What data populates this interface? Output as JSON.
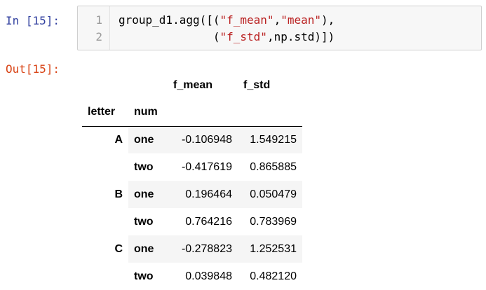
{
  "input_prompt": "In [15]:",
  "output_prompt": "Out[15]:",
  "code": {
    "line_numbers": [
      "1",
      "2"
    ],
    "line1": {
      "p1": "group_d1.agg([(",
      "s1": "\"f_mean\"",
      "p2": ",",
      "s2": "\"mean\"",
      "p3": "),"
    },
    "line2": {
      "indent": "              (",
      "s1": "\"f_std\"",
      "p2": ",np.std)])"
    }
  },
  "dataframe": {
    "columns": [
      "f_mean",
      "f_std"
    ],
    "index_names": [
      "letter",
      "num"
    ],
    "rows": [
      {
        "letter": "A",
        "num": "one",
        "f_mean": "-0.106948",
        "f_std": "1.549215"
      },
      {
        "letter": "",
        "num": "two",
        "f_mean": "-0.417619",
        "f_std": "0.865885"
      },
      {
        "letter": "B",
        "num": "one",
        "f_mean": "0.196464",
        "f_std": "0.050479"
      },
      {
        "letter": "",
        "num": "two",
        "f_mean": "0.764216",
        "f_std": "0.783969"
      },
      {
        "letter": "C",
        "num": "one",
        "f_mean": "-0.278823",
        "f_std": "1.252531"
      },
      {
        "letter": "",
        "num": "two",
        "f_mean": "0.039848",
        "f_std": "0.482120"
      }
    ]
  }
}
